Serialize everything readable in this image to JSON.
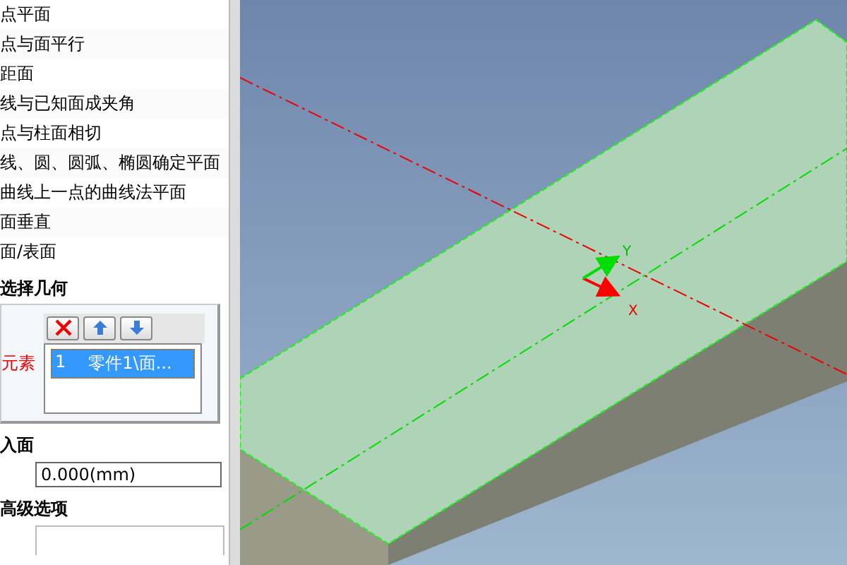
{
  "options": [
    {
      "label": "点平面"
    },
    {
      "label": "点与面平行"
    },
    {
      "label": "距面"
    },
    {
      "label": "线与已知面成夹角"
    },
    {
      "label": "点与柱面相切"
    },
    {
      "label": "线、圆、圆弧、椭圆确定平面"
    },
    {
      "label": "曲线上一点的曲线法平面"
    },
    {
      "label": "面垂直"
    },
    {
      "label": "面/表面"
    }
  ],
  "geometry_section": {
    "title": "选择几何",
    "element_label": "元素",
    "items": [
      {
        "index": "1",
        "text": "零件1\\面...",
        "selected": true
      }
    ]
  },
  "offset_section": {
    "title": "入面",
    "value": "0.000(mm)"
  },
  "advanced_section": {
    "title": "高级选项"
  },
  "viewport": {
    "axis_x": "X",
    "axis_y": "Y"
  }
}
